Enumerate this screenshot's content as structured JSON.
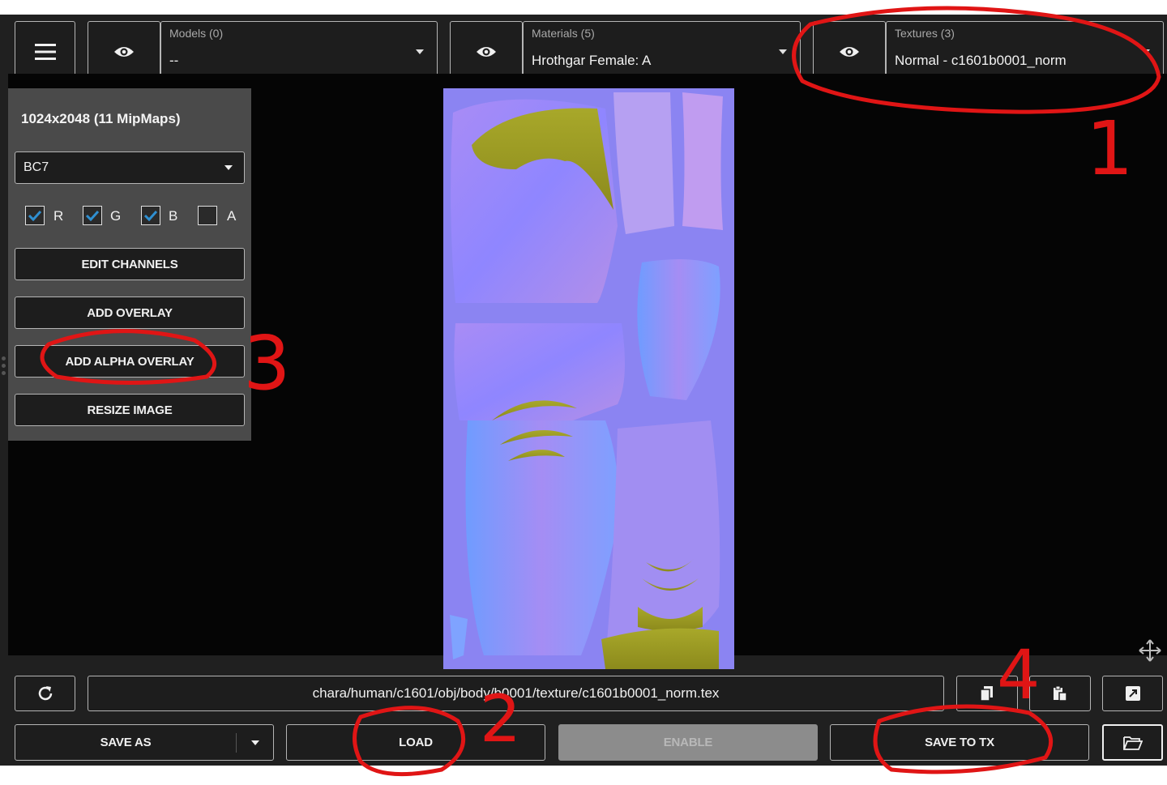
{
  "toolbar": {
    "models": {
      "caption": "Models (0)",
      "value": "--"
    },
    "materials": {
      "caption": "Materials (5)",
      "value": "Hrothgar Female: A"
    },
    "textures": {
      "caption": "Textures (3)",
      "value": "Normal - c1601b0001_norm"
    }
  },
  "panel": {
    "dimensions": "1024x2048 (11 MipMaps)",
    "format": "BC7",
    "channels": [
      {
        "label": "R",
        "checked": true
      },
      {
        "label": "G",
        "checked": true
      },
      {
        "label": "B",
        "checked": true
      },
      {
        "label": "A",
        "checked": false
      }
    ],
    "buttons": {
      "edit_channels": "EDIT CHANNELS",
      "add_overlay": "ADD OVERLAY",
      "add_alpha_overlay": "ADD ALPHA OVERLAY",
      "resize_image": "RESIZE IMAGE"
    }
  },
  "footer": {
    "path": "chara/human/c1601/obj/body/b0001/texture/c1601b0001_norm.tex",
    "save_as": "SAVE AS",
    "load": "LOAD",
    "enable": "ENABLE",
    "save_to_tx": "SAVE TO TX"
  },
  "annotations": {
    "n1": "1",
    "n2": "2",
    "n3": "3",
    "n4": "4",
    "color": "#e01515"
  },
  "colors": {
    "app_bg": "#202020",
    "viewport_bg": "#050505",
    "panel_bg": "#4a4a4a",
    "texture_base": "#8b84f2",
    "check_accent": "#2f8fd0"
  }
}
